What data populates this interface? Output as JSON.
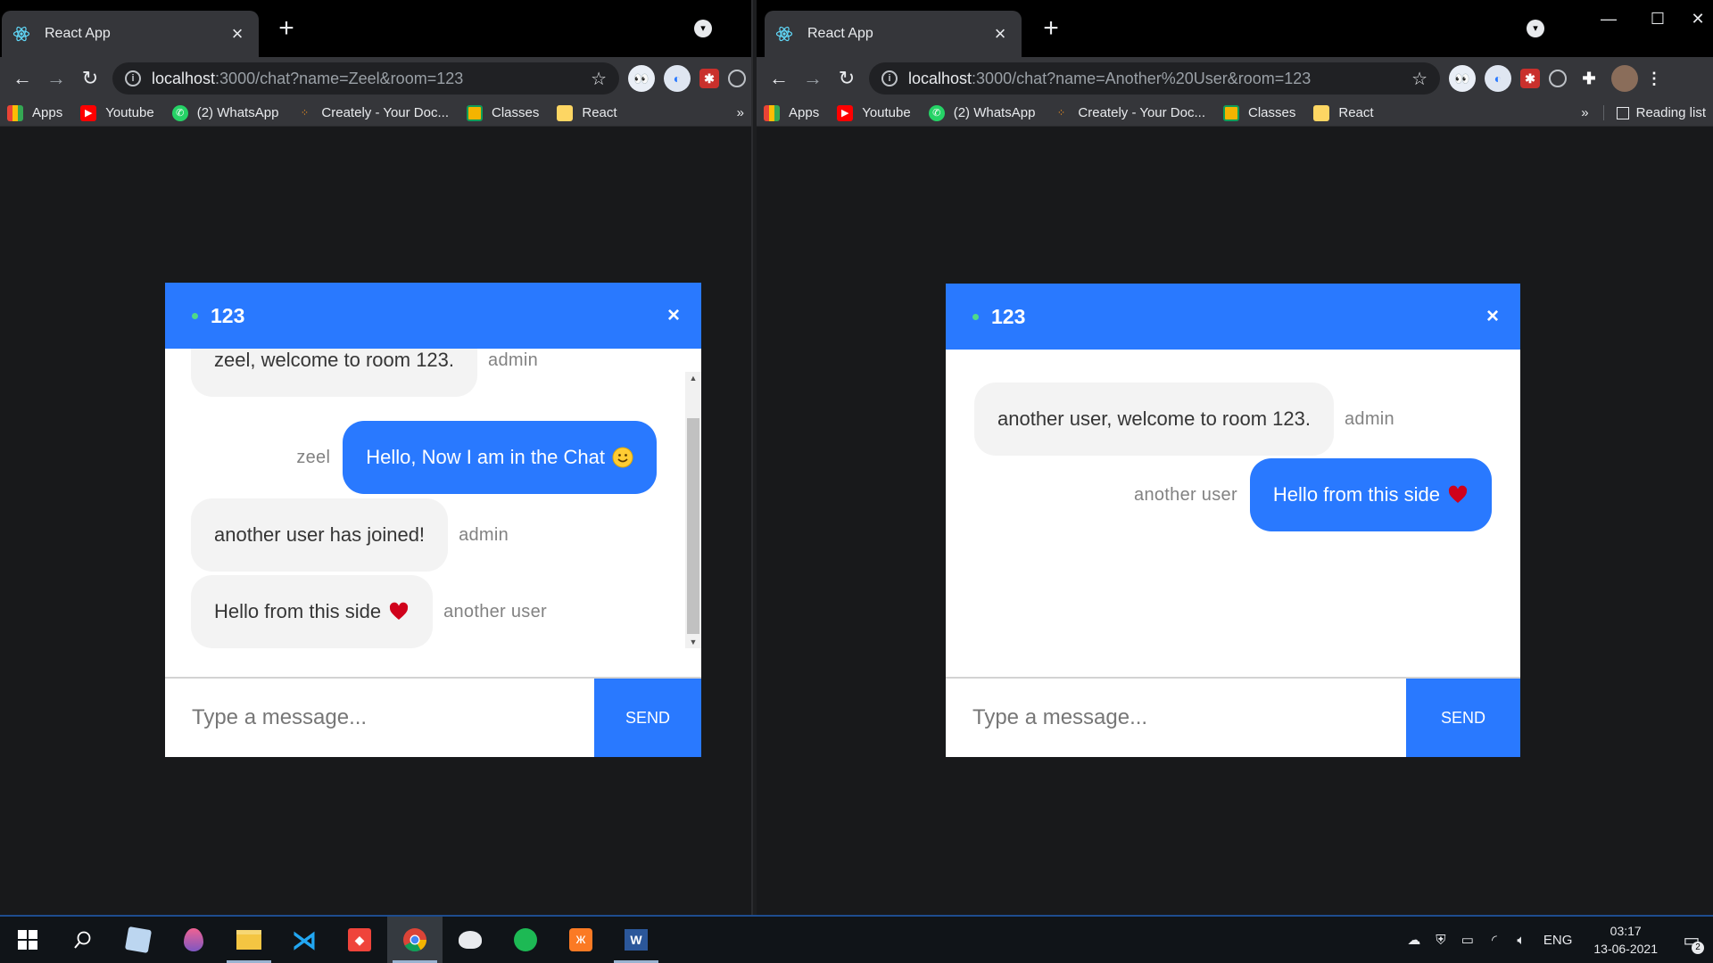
{
  "left_browser": {
    "tab_title": "React App",
    "url_host": "localhost",
    "url_path": ":3000/chat?name=Zeel&room=123",
    "bookmarks": [
      "Apps",
      "Youtube",
      "(2) WhatsApp",
      "Creately - Your Doc...",
      "Classes",
      "React"
    ],
    "bookmarks_more": "»",
    "chat": {
      "room": "123",
      "close": "×",
      "messages": [
        {
          "text": "zeel, welcome to room 123.",
          "sender": "admin",
          "mine": false
        },
        {
          "text": "Hello, Now I am in the Chat",
          "sender": "zeel",
          "mine": true
        },
        {
          "text": "another user has joined!",
          "sender": "admin",
          "mine": false
        },
        {
          "text": "Hello from this side",
          "sender": "another user",
          "mine": false
        }
      ],
      "input_placeholder": "Type a message...",
      "send_label": "SEND"
    }
  },
  "right_browser": {
    "tab_title": "React App",
    "url_host": "localhost",
    "url_path": ":3000/chat?name=Another%20User&room=123",
    "bookmarks": [
      "Apps",
      "Youtube",
      "(2) WhatsApp",
      "Creately - Your Doc...",
      "Classes",
      "React"
    ],
    "bookmarks_more": "»",
    "reading_list": "Reading list",
    "chat": {
      "room": "123",
      "close": "×",
      "messages": [
        {
          "text": "another user, welcome to room 123.",
          "sender": "admin",
          "mine": false
        },
        {
          "text": "Hello from this side",
          "sender": "another user",
          "mine": true
        }
      ],
      "input_placeholder": "Type a message...",
      "send_label": "SEND"
    }
  },
  "taskbar": {
    "language": "ENG",
    "time": "03:17",
    "date": "13-06-2021",
    "notification_count": "2"
  },
  "colors": {
    "chat_blue": "#2979ff",
    "online_green": "#4eda8a",
    "heart_red": "#d0021b",
    "chrome_dark": "#35363a"
  }
}
